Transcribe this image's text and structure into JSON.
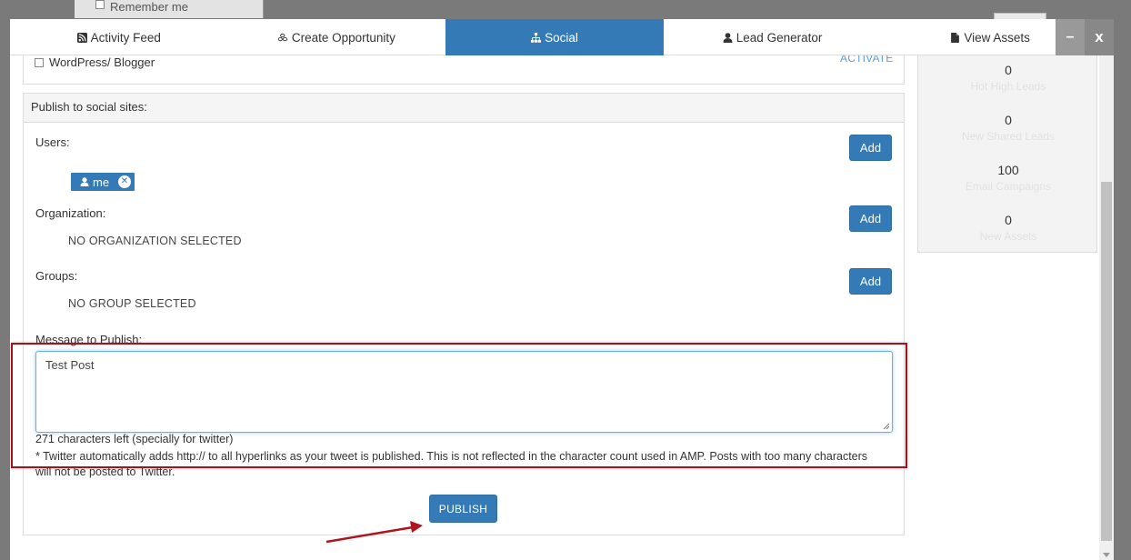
{
  "backdrop": {
    "remember_me": "Remember me"
  },
  "tabs": [
    {
      "label": "Activity Feed",
      "icon": "rss-icon"
    },
    {
      "label": "Create Opportunity",
      "icon": "cubes-icon"
    },
    {
      "label": "Social",
      "icon": "sitemap-icon",
      "active": true
    },
    {
      "label": "Lead Generator",
      "icon": "user-icon"
    },
    {
      "label": "View Assets",
      "icon": "file-icon"
    }
  ],
  "window": {
    "minimize": "–",
    "close": "x"
  },
  "top_panel": {
    "wordpress_label": "WordPress/ Blogger",
    "activate_label": "ACTIVATE"
  },
  "publish": {
    "heading": "Publish to social sites:",
    "users_label": "Users:",
    "organization_label": "Organization:",
    "groups_label": "Groups:",
    "add_label": "Add",
    "user_tag": "me",
    "no_org": "NO ORGANIZATION SELECTED",
    "no_group": "NO GROUP SELECTED",
    "message_label": "Message to Publish:",
    "message_value": "Test Post",
    "chars_left": "271 characters left (specially for twitter)",
    "twitter_note": "* Twitter automatically adds http:// to all hyperlinks as your tweet is published. This is not reflected in the character count used in AMP. Posts with too many characters will not be posted to Twitter.",
    "publish_label": "PUBLISH"
  },
  "stats": [
    {
      "value": "0",
      "label": "Hot High Leads"
    },
    {
      "value": "0",
      "label": "New Shared Leads"
    },
    {
      "value": "100",
      "label": "Email Campaigns"
    },
    {
      "value": "0",
      "label": "New Assets"
    }
  ],
  "colors": {
    "primary": "#337ab7",
    "highlight": "#a0151d",
    "arrow": "#b0151d"
  }
}
